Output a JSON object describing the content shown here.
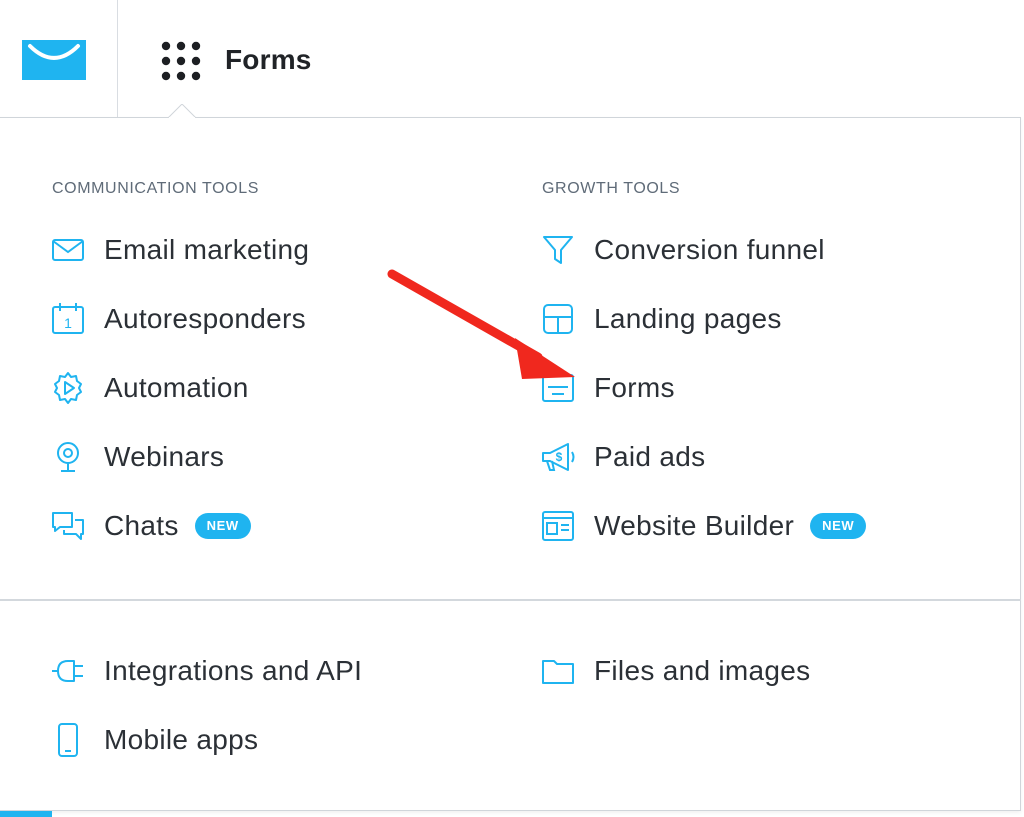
{
  "header": {
    "title": "Forms",
    "logo_icon": "getresponse-envelope-logo",
    "apps_icon": "grid-dots-icon"
  },
  "colors": {
    "accent": "#1fb4f0",
    "arrow": "#f0281e",
    "text": "#2b3036",
    "section": "#5f6b78"
  },
  "menu": {
    "communication": {
      "title": "COMMUNICATION TOOLS",
      "items": [
        {
          "label": "Email marketing",
          "icon": "envelope-icon"
        },
        {
          "label": "Autoresponders",
          "icon": "calendar-icon"
        },
        {
          "label": "Automation",
          "icon": "gear-play-icon"
        },
        {
          "label": "Webinars",
          "icon": "webcam-icon"
        },
        {
          "label": "Chats",
          "icon": "chat-bubbles-icon",
          "badge": "NEW"
        }
      ]
    },
    "growth": {
      "title": "GROWTH TOOLS",
      "items": [
        {
          "label": "Conversion funnel",
          "icon": "funnel-icon"
        },
        {
          "label": "Landing pages",
          "icon": "layout-icon"
        },
        {
          "label": "Forms",
          "icon": "form-icon"
        },
        {
          "label": "Paid ads",
          "icon": "megaphone-icon"
        },
        {
          "label": "Website Builder",
          "icon": "website-icon",
          "badge": "NEW"
        }
      ]
    },
    "other": {
      "items": [
        {
          "label": "Integrations and API",
          "icon": "plug-icon"
        },
        {
          "label": "Files and images",
          "icon": "folder-icon"
        },
        {
          "label": "Mobile apps",
          "icon": "smartphone-icon"
        }
      ]
    }
  },
  "annotation": {
    "arrow_icon": "red-arrow-pointer"
  }
}
